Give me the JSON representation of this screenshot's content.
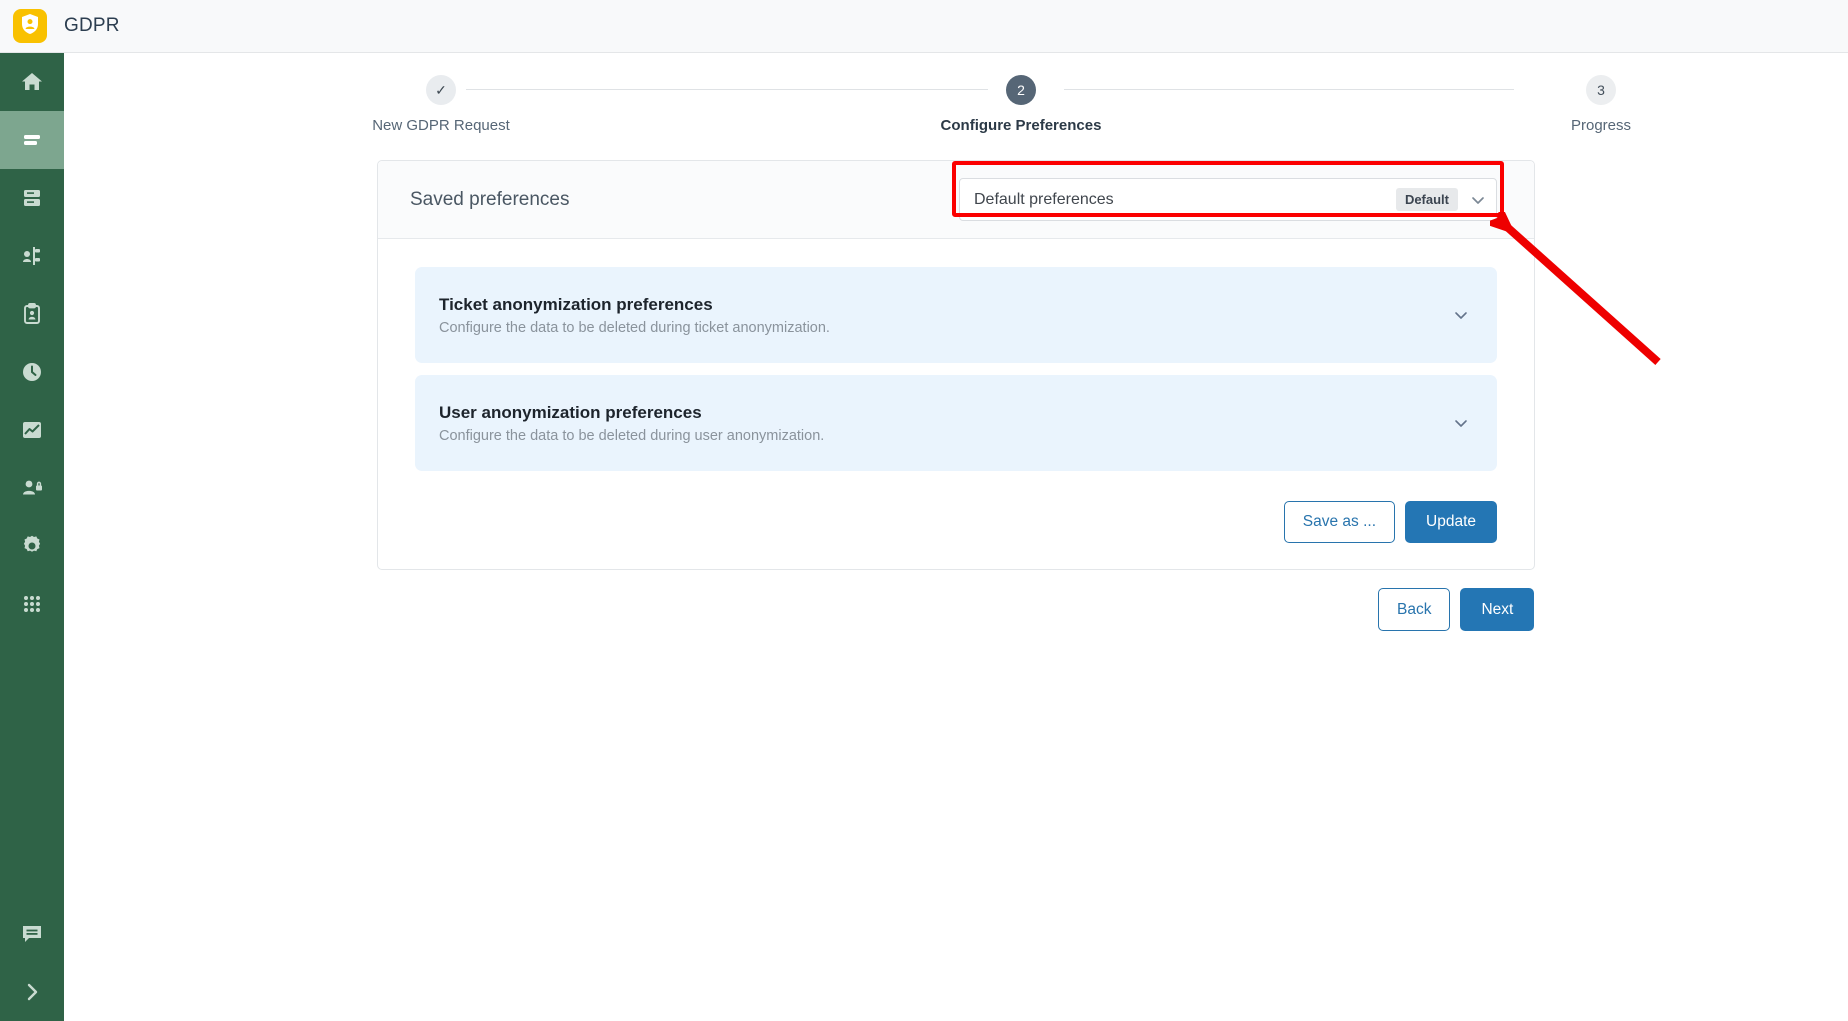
{
  "app": {
    "title": "GDPR",
    "logo_icon": "shield-person-icon",
    "logo_color": "#f9c100"
  },
  "sidebar": {
    "background": "#2f6347",
    "items": [
      {
        "name": "home",
        "icon": "home-icon",
        "active": false
      },
      {
        "name": "requests",
        "icon": "list-lines-icon",
        "active": true
      },
      {
        "name": "database",
        "icon": "database-icon",
        "active": false
      },
      {
        "name": "workflows",
        "icon": "workflow-icon",
        "active": false
      },
      {
        "name": "records",
        "icon": "clipboard-person-icon",
        "active": false
      },
      {
        "name": "history",
        "icon": "clock-icon",
        "active": false
      },
      {
        "name": "reports",
        "icon": "chart-image-icon",
        "active": false
      },
      {
        "name": "privacy",
        "icon": "user-lock-icon",
        "active": false
      },
      {
        "name": "settings",
        "icon": "gear-icon",
        "active": false
      },
      {
        "name": "apps",
        "icon": "grid-apps-icon",
        "active": false
      }
    ],
    "bottom_items": [
      {
        "name": "chat",
        "icon": "chat-bubble-icon"
      },
      {
        "name": "expand",
        "icon": "chevron-right-icon"
      }
    ]
  },
  "stepper": {
    "steps": [
      {
        "marker": "✓",
        "label": "New GDPR Request",
        "state": "done"
      },
      {
        "marker": "2",
        "label": "Configure Preferences",
        "state": "current"
      },
      {
        "marker": "3",
        "label": "Progress",
        "state": "todo"
      }
    ]
  },
  "card": {
    "header_title": "Saved preferences",
    "dropdown": {
      "value": "Default preferences",
      "badge": "Default",
      "chevron_icon": "chevron-down-icon"
    },
    "accordions": [
      {
        "title": "Ticket anonymization preferences",
        "subtitle": "Configure the data to be deleted during ticket anonymization.",
        "chevron_icon": "chevron-down-icon"
      },
      {
        "title": "User anonymization preferences",
        "subtitle": "Configure the data to be deleted during user anonymization.",
        "chevron_icon": "chevron-down-icon"
      }
    ],
    "actions": {
      "save_as_label": "Save as ...",
      "update_label": "Update"
    }
  },
  "wizard": {
    "back_label": "Back",
    "next_label": "Next"
  },
  "annotation": {
    "highlight_color": "#fb0000",
    "arrow_color": "#ee0000",
    "target": "saved-preferences-dropdown"
  },
  "colors": {
    "primary_blue": "#2476b4",
    "sidebar_green": "#2f6347",
    "accordion_blue": "#eaf4fd",
    "brand_yellow": "#f9c100"
  }
}
